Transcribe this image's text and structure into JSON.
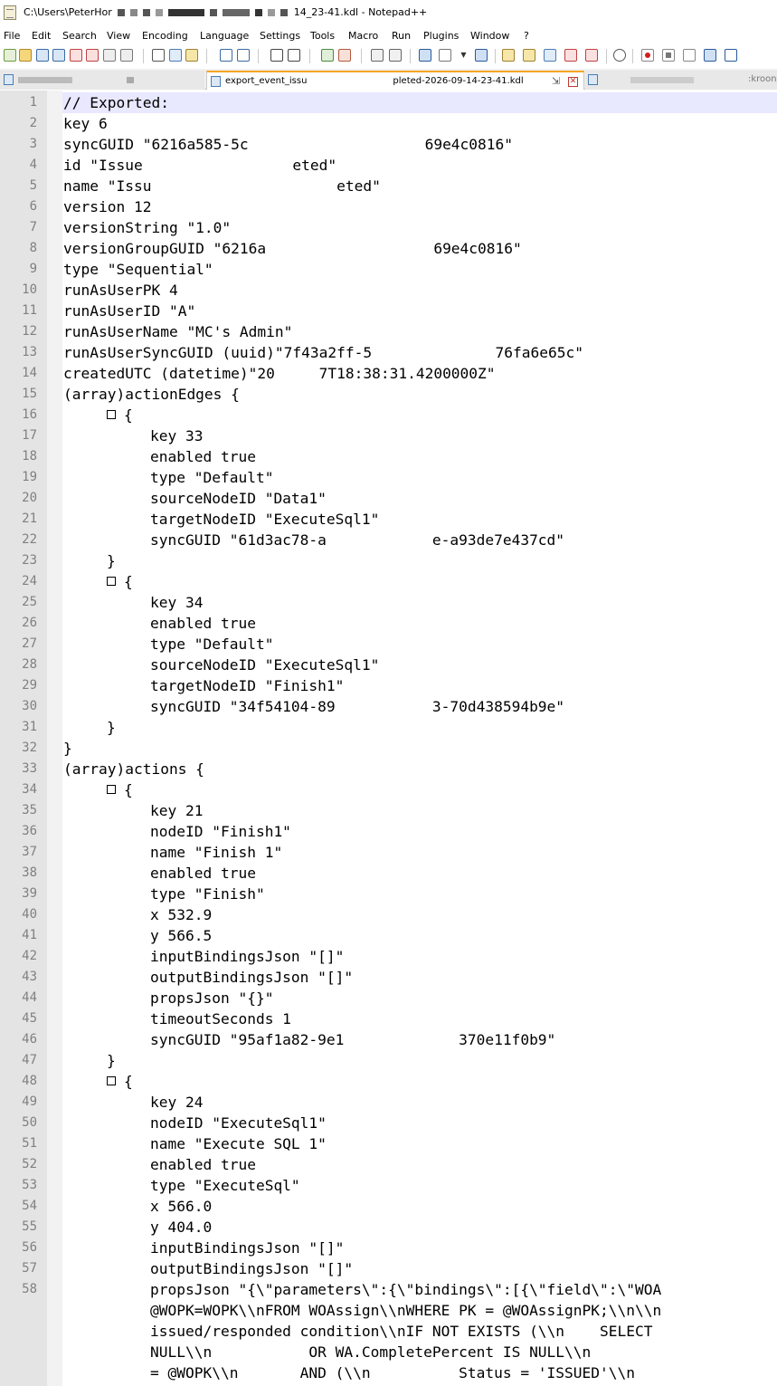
{
  "window": {
    "title_prefix": "C:\\Users\\PeterHor",
    "title_suffix": "14_23-41.kdl - Notepad++"
  },
  "menu": [
    "File",
    "Edit",
    "Search",
    "View",
    "Encoding",
    "Language",
    "Settings",
    "Tools",
    "Macro",
    "Run",
    "Plugins",
    "Window",
    "?"
  ],
  "tabs": {
    "inactive_right_label": ":kroon",
    "active_label_left": "export_event_issu",
    "active_label_right": "pleted-2026-09-14-23-41.kdl",
    "pin_glyph": "⇲",
    "close_glyph": "✕"
  },
  "editor": {
    "lines": [
      {
        "n": "1",
        "indent": 0,
        "text": "// Exported: "
      },
      {
        "n": "2",
        "indent": 0,
        "text": "key 6"
      },
      {
        "n": "3",
        "indent": 0,
        "text": "syncGUID \"6216a585-5c                    69e4c0816\""
      },
      {
        "n": "4",
        "indent": 0,
        "text": "id \"Issue                 eted\""
      },
      {
        "n": "5",
        "indent": 0,
        "text": "name \"Issu                     eted\""
      },
      {
        "n": "6",
        "indent": 0,
        "text": "version 12"
      },
      {
        "n": "7",
        "indent": 0,
        "text": "versionString \"1.0\""
      },
      {
        "n": "8",
        "indent": 0,
        "text": "versionGroupGUID \"6216a                   69e4c0816\""
      },
      {
        "n": "9",
        "indent": 0,
        "text": "type \"Sequential\""
      },
      {
        "n": "10",
        "indent": 0,
        "text": "runAsUserPK 4"
      },
      {
        "n": "11",
        "indent": 0,
        "text": "runAsUserID \"A\""
      },
      {
        "n": "12",
        "indent": 0,
        "text": "runAsUserName \"MC's Admin\""
      },
      {
        "n": "13",
        "indent": 0,
        "text": "runAsUserSyncGUID (uuid)\"7f43a2ff-5              76fa6e65c\""
      },
      {
        "n": "14",
        "indent": 0,
        "text": "createdUTC (datetime)\"20     7T18:38:31.4200000Z\""
      },
      {
        "n": "15",
        "indent": 0,
        "text": "(array)actionEdges {"
      },
      {
        "n": "16",
        "indent": 1,
        "text": "{",
        "fold": true
      },
      {
        "n": "17",
        "indent": 2,
        "text": "key 33"
      },
      {
        "n": "18",
        "indent": 2,
        "text": "enabled true"
      },
      {
        "n": "19",
        "indent": 2,
        "text": "type \"Default\""
      },
      {
        "n": "20",
        "indent": 2,
        "text": "sourceNodeID \"Data1\""
      },
      {
        "n": "21",
        "indent": 2,
        "text": "targetNodeID \"ExecuteSql1\""
      },
      {
        "n": "22",
        "indent": 2,
        "text": "syncGUID \"61d3ac78-a            e-a93de7e437cd\""
      },
      {
        "n": "23",
        "indent": 1,
        "text": "}"
      },
      {
        "n": "24",
        "indent": 1,
        "text": "{",
        "fold": true
      },
      {
        "n": "25",
        "indent": 2,
        "text": "key 34"
      },
      {
        "n": "26",
        "indent": 2,
        "text": "enabled true"
      },
      {
        "n": "27",
        "indent": 2,
        "text": "type \"Default\""
      },
      {
        "n": "28",
        "indent": 2,
        "text": "sourceNodeID \"ExecuteSql1\""
      },
      {
        "n": "29",
        "indent": 2,
        "text": "targetNodeID \"Finish1\""
      },
      {
        "n": "30",
        "indent": 2,
        "text": "syncGUID \"34f54104-89           3-70d438594b9e\""
      },
      {
        "n": "31",
        "indent": 1,
        "text": "}"
      },
      {
        "n": "32",
        "indent": 0,
        "text": "}"
      },
      {
        "n": "33",
        "indent": 0,
        "text": "(array)actions {"
      },
      {
        "n": "34",
        "indent": 1,
        "text": "{",
        "fold": true
      },
      {
        "n": "35",
        "indent": 2,
        "text": "key 21"
      },
      {
        "n": "36",
        "indent": 2,
        "text": "nodeID \"Finish1\""
      },
      {
        "n": "37",
        "indent": 2,
        "text": "name \"Finish 1\""
      },
      {
        "n": "38",
        "indent": 2,
        "text": "enabled true"
      },
      {
        "n": "39",
        "indent": 2,
        "text": "type \"Finish\""
      },
      {
        "n": "40",
        "indent": 2,
        "text": "x 532.9"
      },
      {
        "n": "41",
        "indent": 2,
        "text": "y 566.5"
      },
      {
        "n": "42",
        "indent": 2,
        "text": "inputBindingsJson \"[]\""
      },
      {
        "n": "43",
        "indent": 2,
        "text": "outputBindingsJson \"[]\""
      },
      {
        "n": "44",
        "indent": 2,
        "text": "propsJson \"{}\""
      },
      {
        "n": "45",
        "indent": 2,
        "text": "timeoutSeconds 1"
      },
      {
        "n": "46",
        "indent": 2,
        "text": "syncGUID \"95af1a82-9e1             370e11f0b9\""
      },
      {
        "n": "47",
        "indent": 1,
        "text": "}"
      },
      {
        "n": "48",
        "indent": 1,
        "text": "{",
        "fold": true
      },
      {
        "n": "49",
        "indent": 2,
        "text": "key 24"
      },
      {
        "n": "50",
        "indent": 2,
        "text": "nodeID \"ExecuteSql1\""
      },
      {
        "n": "51",
        "indent": 2,
        "text": "name \"Execute SQL 1\""
      },
      {
        "n": "52",
        "indent": 2,
        "text": "enabled true"
      },
      {
        "n": "53",
        "indent": 2,
        "text": "type \"ExecuteSql\""
      },
      {
        "n": "54",
        "indent": 2,
        "text": "x 566.0"
      },
      {
        "n": "55",
        "indent": 2,
        "text": "y 404.0"
      },
      {
        "n": "56",
        "indent": 2,
        "text": "inputBindingsJson \"[]\""
      },
      {
        "n": "57",
        "indent": 2,
        "text": "outputBindingsJson \"[]\""
      },
      {
        "n": "58",
        "indent": 2,
        "text": "propsJson \"{\\\"parameters\\\":{\\\"bindings\\\":[{\\\"field\\\":\\\"WOA"
      },
      {
        "n": "",
        "indent": 2,
        "text": "@WOPK=WOPK\\\\nFROM WOAssign\\\\nWHERE PK = @WOAssignPK;\\\\n\\\\n"
      },
      {
        "n": "",
        "indent": 2,
        "text": "issued/responded condition\\\\nIF NOT EXISTS (\\\\n    SELECT"
      },
      {
        "n": "",
        "indent": 2,
        "text": "NULL\\\\n           OR WA.CompletePercent IS NULL\\\\n"
      },
      {
        "n": "",
        "indent": 2,
        "text": "= @WOPK\\\\n       AND (\\\\n          Status = 'ISSUED'\\\\n"
      }
    ]
  }
}
